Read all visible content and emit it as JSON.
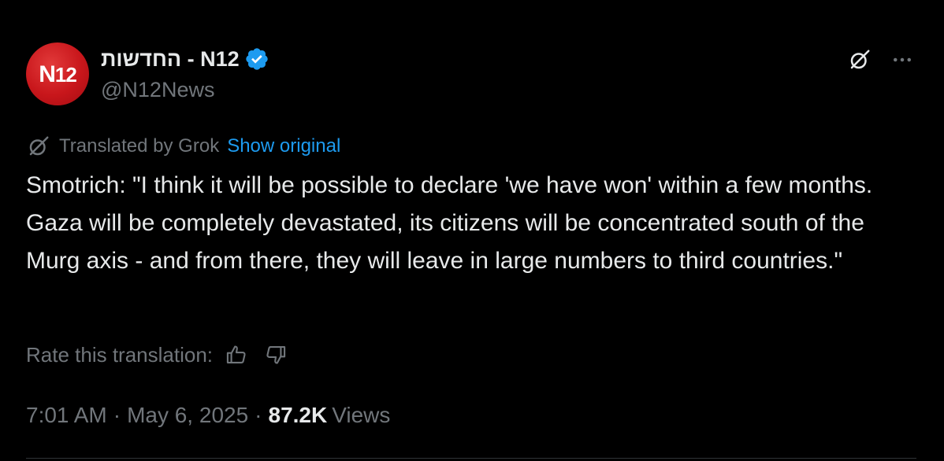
{
  "author": {
    "avatar_text_main": "N",
    "avatar_text_num": "12",
    "display_name": "החדשות - N12",
    "handle": "@N12News",
    "verified": true,
    "avatar_color": "#c8161b",
    "verified_color": "#1d9bf0"
  },
  "icons": {
    "verified": "verified-badge-icon",
    "grok": "grok-icon",
    "more": "more-dots-icon",
    "translate": "grok-icon",
    "thumbs_up": "thumbs-up-icon",
    "thumbs_down": "thumbs-down-icon"
  },
  "translation": {
    "label": "Translated by Grok",
    "show_original": "Show original",
    "link_color": "#1d9bf0"
  },
  "tweet": {
    "text": "Smotrich: \"I think it will be possible to declare 'we have won' within a few months. Gaza will be completely devastated, its citizens will be concentrated south of the Murg axis - and from there, they will leave in large numbers to third countries.\""
  },
  "rating": {
    "label": "Rate this translation:"
  },
  "meta": {
    "time": "7:01 AM",
    "separator": "·",
    "date": "May 6, 2025",
    "views_count": "87.2K",
    "views_label": "Views"
  }
}
